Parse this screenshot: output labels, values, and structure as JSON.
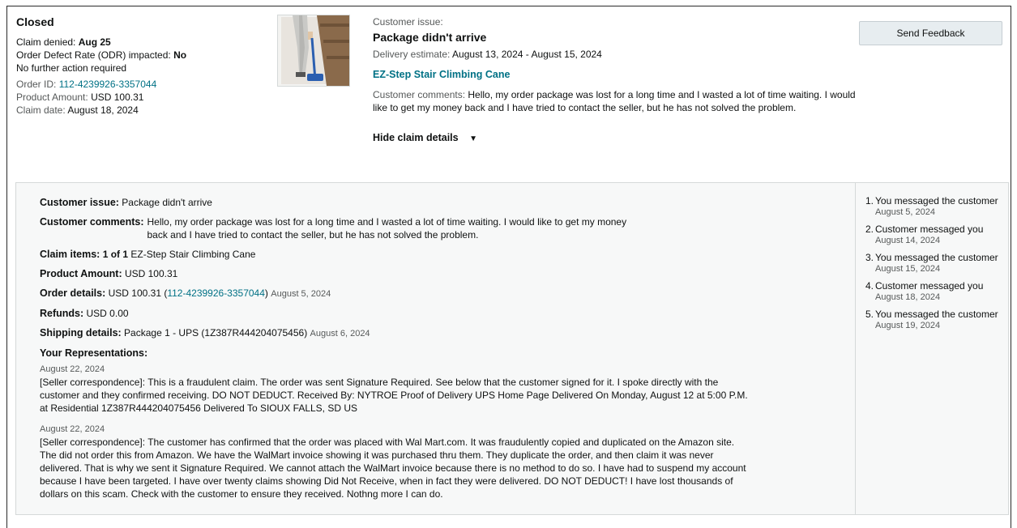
{
  "claim": {
    "status": "Closed",
    "denied_label": "Claim denied:",
    "denied_value": "Aug 25",
    "odr_label": "Order Defect Rate (ODR) impacted:",
    "odr_value": "No",
    "action_note": "No further action required",
    "order_id_label": "Order ID:",
    "order_id": "112-4239926-3357044",
    "product_amount_label": "Product Amount:",
    "product_amount": "USD 100.31",
    "claim_date_label": "Claim date:",
    "claim_date": "August 18, 2024"
  },
  "issue": {
    "section_label": "Customer issue:",
    "title": "Package didn't arrive",
    "delivery_label": "Delivery estimate:",
    "delivery_value": "August 13, 2024 - August 15, 2024",
    "product_name": "EZ-Step Stair Climbing Cane",
    "comments_label": "Customer comments:",
    "comments": "Hello, my order package was lost for a long time and I wasted a lot of time waiting. I would like to get my money back and I have tried to contact the seller, but he has not solved the problem.",
    "toggle_label": "Hide claim details"
  },
  "actions": {
    "send_feedback": "Send Feedback"
  },
  "details": {
    "issue_label": "Customer issue:",
    "issue_value": "Package didn't arrive",
    "comments_label": "Customer comments:",
    "comments_value": "Hello, my order package was lost for a long time and I wasted a lot of time waiting. I would like to get my money back and I have tried to contact the seller, but he has not solved the problem.",
    "items_label": "Claim items:",
    "items_count": "1 of 1",
    "items_value": "EZ-Step Stair Climbing Cane",
    "amount_label": "Product Amount:",
    "amount_value": "USD 100.31",
    "order_label": "Order details:",
    "order_amount": "USD 100.31",
    "order_paren_open": "(",
    "order_id": "112-4239926-3357044",
    "order_paren_close": ")",
    "order_date": "August 5, 2024",
    "refunds_label": "Refunds:",
    "refunds_value": "USD 0.00",
    "shipping_label": "Shipping details:",
    "shipping_value": "Package 1 - UPS (1Z387R444204075456)",
    "shipping_date": "August 6, 2024",
    "reps_label": "Your Representations:",
    "representations": [
      {
        "date": "August 22, 2024",
        "text": "[Seller correspondence]: This is a fraudulent claim. The order was sent Signature Required. See below that the customer signed for it. I spoke directly with the customer and they confirmed receiving. DO NOT DEDUCT. Received By: NYTROE Proof of Delivery UPS Home Page Delivered On Monday, August 12 at 5:00 P.M. at Residential 1Z387R444204075456 Delivered To SIOUX FALLS, SD US"
      },
      {
        "date": "August 22, 2024",
        "text": "[Seller correspondence]: The customer has confirmed that the order was placed with Wal Mart.com. It was fraudulently copied and duplicated on the Amazon site. The did not order this from Amazon. We have the WalMart invoice showing it was purchased thru them. They duplicate the order, and then claim it was never delivered. That is why we sent it Signature Required. We cannot attach the WalMart invoice because there is no method to do so. I have had to suspend my account because I have been targeted. I have over twenty claims showing Did Not Receive, when in fact they were delivered. DO NOT DEDUCT! I have lost thousands of dollars on this scam. Check with the customer to ensure they received. Nothng more I can do."
      }
    ]
  },
  "timeline": [
    {
      "num": "1.",
      "event": "You messaged the customer",
      "date": "August 5, 2024"
    },
    {
      "num": "2.",
      "event": "Customer messaged you",
      "date": "August 14, 2024"
    },
    {
      "num": "3.",
      "event": "You messaged the customer",
      "date": "August 15, 2024"
    },
    {
      "num": "4.",
      "event": "Customer messaged you",
      "date": "August 18, 2024"
    },
    {
      "num": "5.",
      "event": "You messaged the customer",
      "date": "August 19, 2024"
    }
  ],
  "icons": {
    "toggle": "caret-down-icon",
    "product_image": "product-thumbnail"
  }
}
